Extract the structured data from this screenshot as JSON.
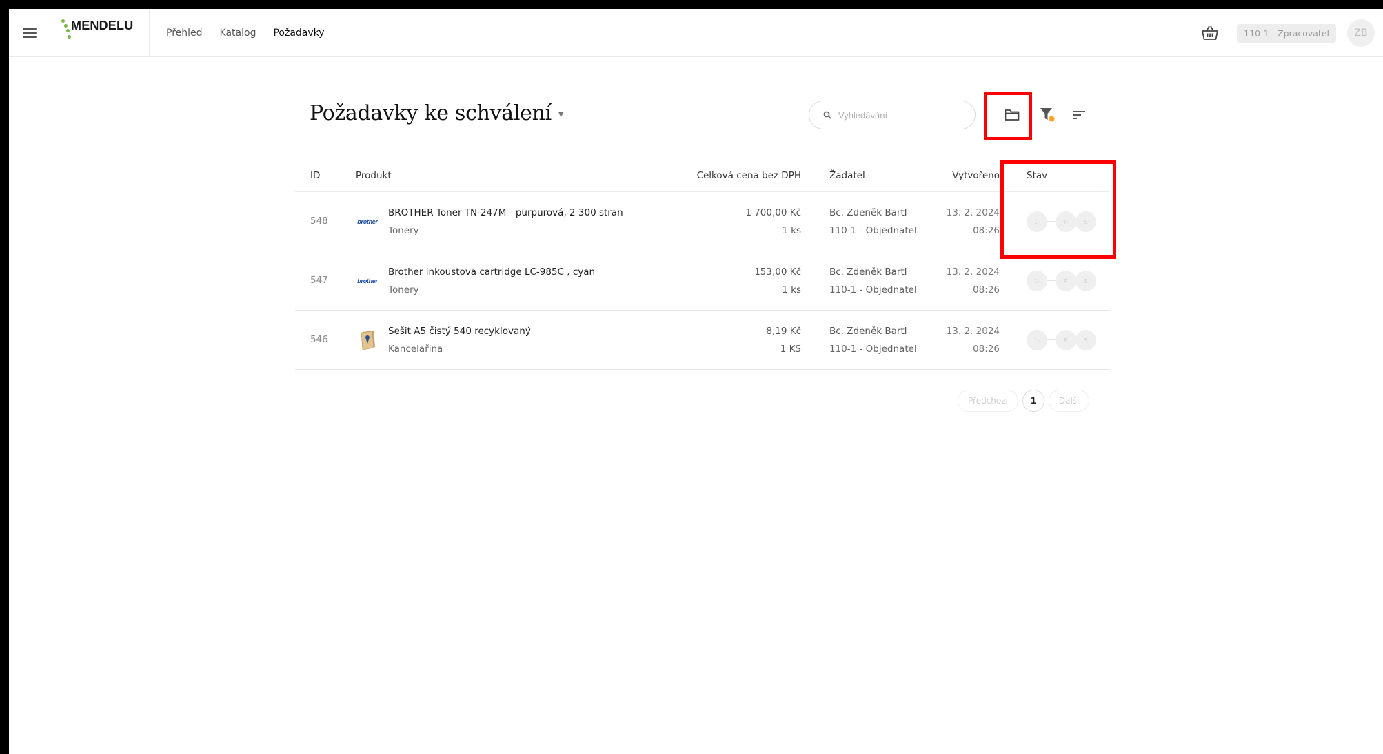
{
  "header": {
    "logo_text": "MENDELU",
    "nav": [
      {
        "label": "Přehled",
        "active": false
      },
      {
        "label": "Katalog",
        "active": false
      },
      {
        "label": "Požadavky",
        "active": true
      }
    ],
    "role": "110-1 - Zpracovatel",
    "avatar_initials": "ZB"
  },
  "page": {
    "title": "Požadavky ke schválení",
    "search_placeholder": "Vyhledávání"
  },
  "table": {
    "columns": {
      "id": "ID",
      "product": "Produkt",
      "price": "Celková cena bez DPH",
      "requester": "Žadatel",
      "created": "Vytvořeno",
      "state": "Stav"
    },
    "rows": [
      {
        "id": "548",
        "logo": "brother",
        "name": "BROTHER Toner TN-247M - purpurová, 2 300 stran",
        "category": "Tonery",
        "price": "1 700,00 Kč",
        "qty": "1 ks",
        "requester": "Bc. Zdeněk Bartl",
        "dept": "110-1 - Objednatel",
        "date": "13. 2. 2024",
        "time": "08:26",
        "steps": [
          "1-",
          "P",
          "S"
        ]
      },
      {
        "id": "547",
        "logo": "brother",
        "name": "Brother inkoustova cartridge LC-985C , cyan",
        "category": "Tonery",
        "price": "153,00 Kč",
        "qty": "1 ks",
        "requester": "Bc. Zdeněk Bartl",
        "dept": "110-1 - Objednatel",
        "date": "13. 2. 2024",
        "time": "08:26",
        "steps": [
          "1-",
          "P",
          "S"
        ]
      },
      {
        "id": "546",
        "logo": "notebook",
        "name": "Sešit A5 čistý 540 recyklovaný",
        "category": "Kancelařina",
        "price": "8,19 Kč",
        "qty": "1 KS",
        "requester": "Bc. Zdeněk Bartl",
        "dept": "110-1 - Objednatel",
        "date": "13. 2. 2024",
        "time": "08:26",
        "steps": [
          "1-",
          "P",
          "S"
        ]
      }
    ]
  },
  "pagination": {
    "prev": "Předchozí",
    "current": "1",
    "next": "Další"
  },
  "brand": {
    "logo_text": "brother"
  },
  "colors": {
    "highlight": "#ff0000",
    "filter_dot": "#f5a623",
    "logo_green": "#79b743"
  }
}
